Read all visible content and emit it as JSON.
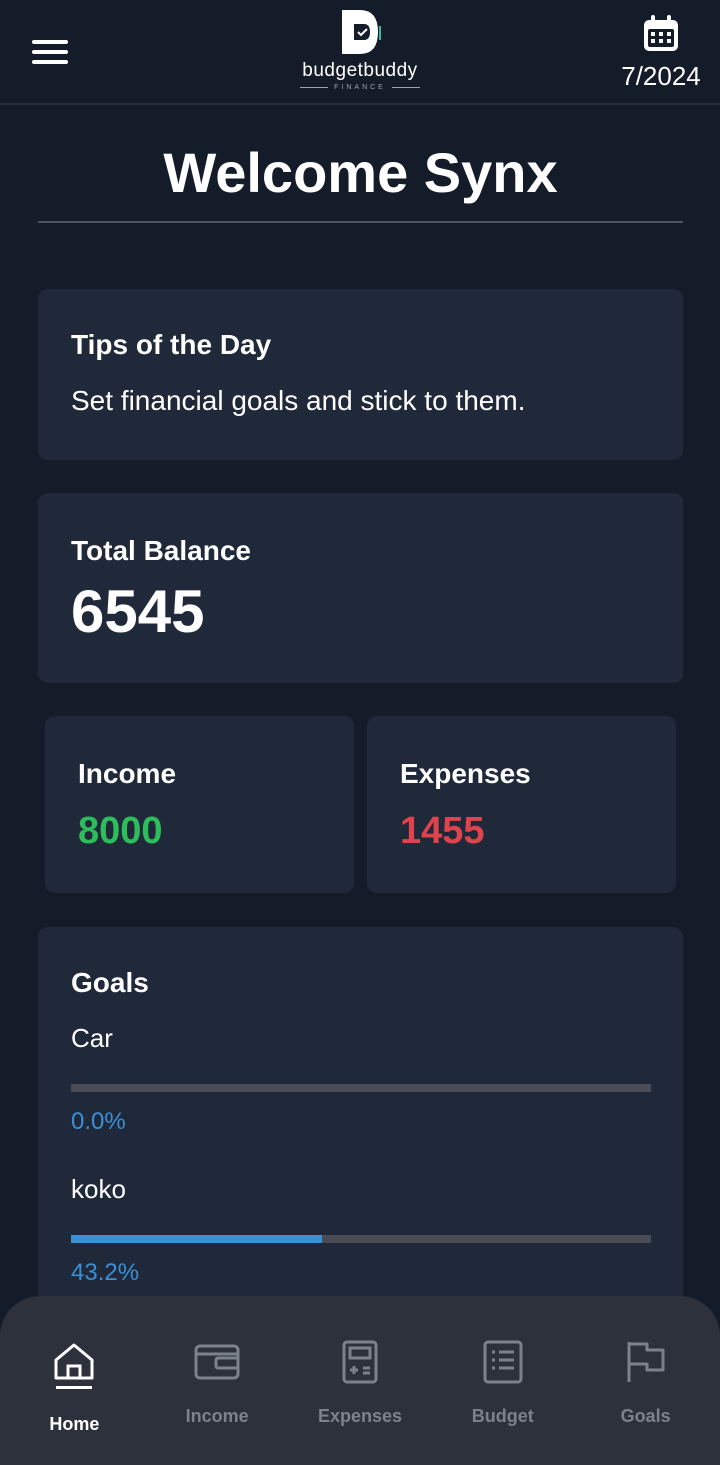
{
  "header": {
    "menu_icon": "hamburger-menu-icon",
    "logo_name": "budgetbuddy",
    "logo_tagline": "FINANCE",
    "calendar_icon": "calendar-icon",
    "date": "7/2024"
  },
  "welcome": "Welcome Synx",
  "tips": {
    "title": "Tips of the Day",
    "text": "Set financial goals and stick to them."
  },
  "balance": {
    "title": "Total Balance",
    "value": "6545"
  },
  "income": {
    "title": "Income",
    "value": "8000",
    "color": "#2ebd5b"
  },
  "expenses": {
    "title": "Expenses",
    "value": "1455",
    "color": "#e0434c"
  },
  "goals": {
    "title": "Goals",
    "items": [
      {
        "name": "Car",
        "progress": 0.0,
        "label": "0.0%"
      },
      {
        "name": "koko",
        "progress": 0.432,
        "label": "43.2%"
      }
    ]
  },
  "nav": {
    "items": [
      {
        "label": "Home",
        "icon": "home-icon",
        "active": true
      },
      {
        "label": "Income",
        "icon": "wallet-icon",
        "active": false
      },
      {
        "label": "Expenses",
        "icon": "calculator-icon",
        "active": false
      },
      {
        "label": "Budget",
        "icon": "list-icon",
        "active": false
      },
      {
        "label": "Goals",
        "icon": "flag-icon",
        "active": false
      }
    ]
  },
  "colors": {
    "background": "#151c29",
    "card": "#1f293a",
    "accent": "#3a8fd6",
    "nav_bg": "#2c313b"
  }
}
